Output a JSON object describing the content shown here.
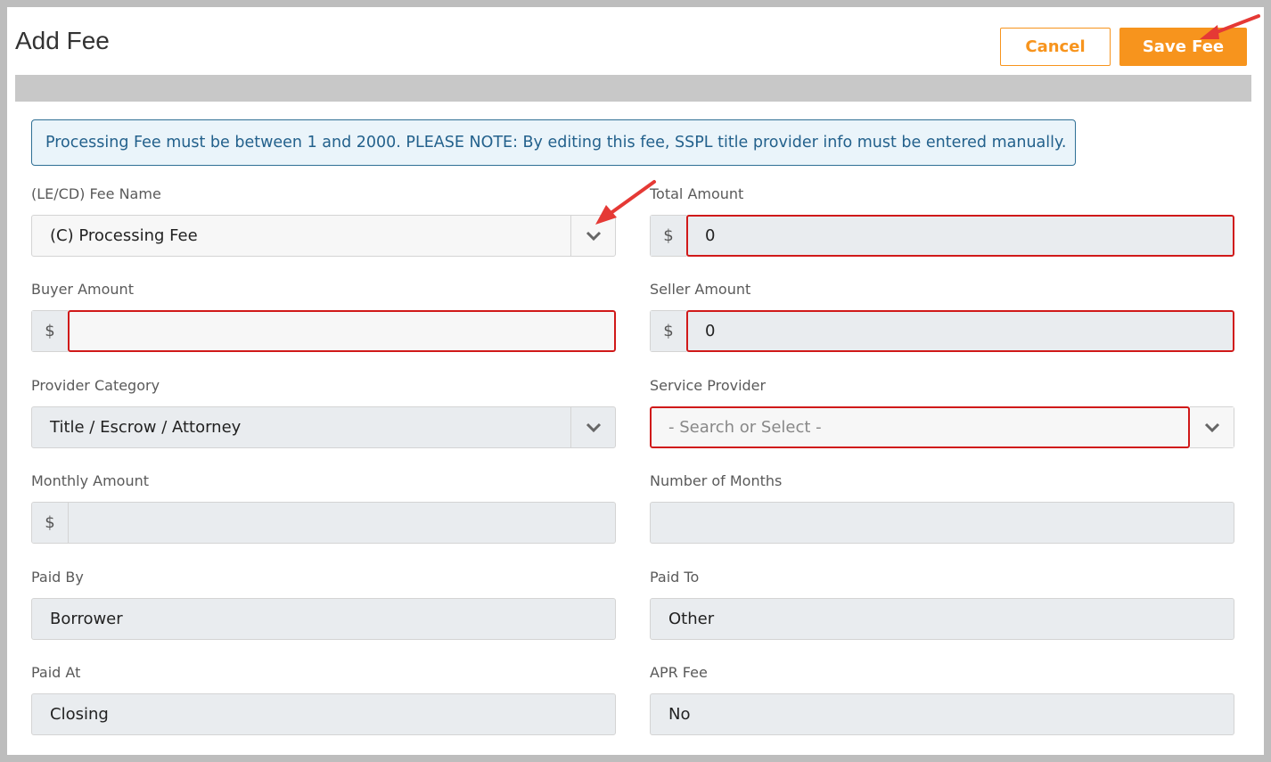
{
  "header": {
    "title": "Add Fee",
    "cancel_label": "Cancel",
    "save_label": "Save Fee"
  },
  "notice": "Processing Fee must be between 1 and 2000. PLEASE NOTE: By editing this fee, SSPL title provider info must be entered manually.",
  "form": {
    "fee_name": {
      "label": "(LE/CD) Fee Name",
      "value": "(C) Processing Fee"
    },
    "total_amount": {
      "label": "Total Amount",
      "currency": "$",
      "value": "0"
    },
    "buyer_amount": {
      "label": "Buyer Amount",
      "currency": "$",
      "value": ""
    },
    "seller_amount": {
      "label": "Seller Amount",
      "currency": "$",
      "value": "0"
    },
    "provider_category": {
      "label": "Provider Category",
      "value": "Title / Escrow / Attorney"
    },
    "service_provider": {
      "label": "Service Provider",
      "placeholder": "- Search or Select -"
    },
    "monthly_amount": {
      "label": "Monthly Amount",
      "currency": "$",
      "value": ""
    },
    "number_of_months": {
      "label": "Number of Months",
      "value": ""
    },
    "paid_by": {
      "label": "Paid By",
      "value": "Borrower"
    },
    "paid_to": {
      "label": "Paid To",
      "value": "Other"
    },
    "paid_at": {
      "label": "Paid At",
      "value": "Closing"
    },
    "apr_fee": {
      "label": "APR Fee",
      "value": "No"
    }
  },
  "colors": {
    "accent": "#f7941d",
    "error": "#d01919",
    "notice_text": "#23618c",
    "annotation_arrow": "#e53935"
  },
  "icons": {
    "dropdown": "chevron-down-icon",
    "annotation": "red-arrow-annotation"
  }
}
